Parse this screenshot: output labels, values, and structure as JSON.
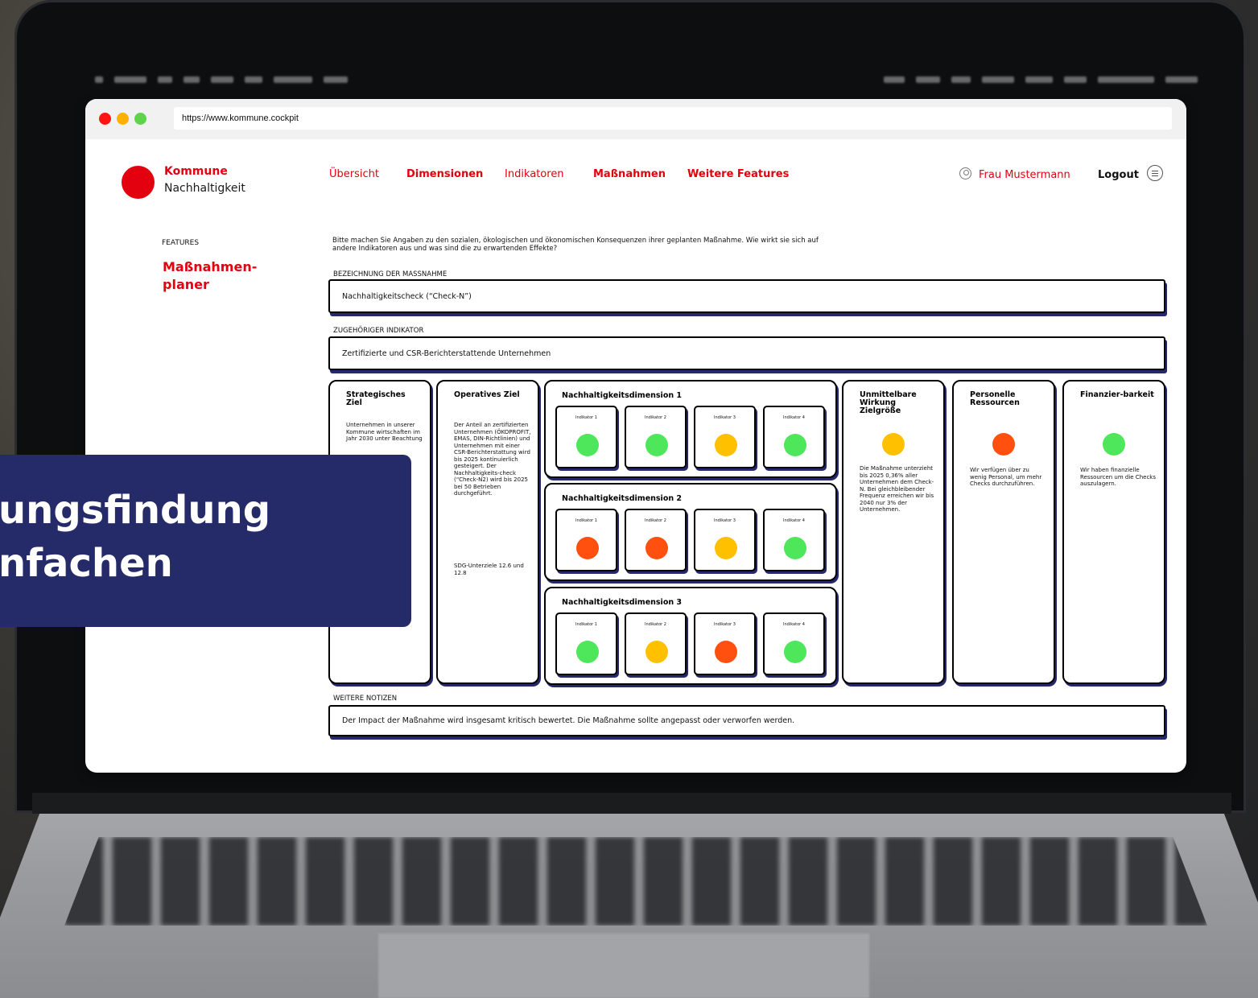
{
  "colors": {
    "accent": "#e3000f",
    "navy": "#252a68",
    "green": "#4ee65b",
    "yellow": "#ffc000",
    "orange": "#ff5010"
  },
  "browser": {
    "url": "https://www.kommune.cockpit"
  },
  "header": {
    "brand_line1": "Kommune",
    "brand_line2": "Nachhaltigkeit",
    "nav": [
      "Übersicht",
      "Dimensionen",
      "Indikatoren",
      "Maßnahmen",
      "Weitere Features"
    ],
    "user_name": "Frau Mustermann",
    "logout": "Logout"
  },
  "sidebar": {
    "label": "FEATURES",
    "title": "Maßnahmen-planer"
  },
  "form": {
    "intro": "Bitte machen Sie Angaben zu den sozialen, ökologischen und ökonomischen Konsequenzen ihrer geplanten Maßnahme. Wie wirkt sie sich auf andere Indikatoren aus und was sind die zu erwartenden Effekte?",
    "name_label": "BEZEICHNUNG DER MASSNAHME",
    "name_value": "Nachhaltigkeitscheck (“Check-N”)",
    "indicator_label": "ZUGEHÖRIGER INDIKATOR",
    "indicator_value": "Zertifizierte und CSR-Berichterstattende Unternehmen",
    "notes_label": "WEITERE NOTIZEN",
    "notes_value": "Der Impact der Maßnahme wird insgesamt kritisch bewertet. Die Maßnahme sollte angepasst  oder verworfen werden."
  },
  "columns": {
    "strategic": {
      "title": "Strategisches Ziel",
      "text": "Unternehmen in unserer Kommune wirtschaften im Jahr 2030 unter Beachtung"
    },
    "operative": {
      "title": "Operatives Ziel",
      "text": "Der Anteil an zertifizierten Unternehmen (ÖKOPROFIT, EMAS, DIN-Richtlinien) und Unternehmen mit einer CSR-Berichterstattung wird bis 2025 kontinuierlich gesteigert. Der Nachhaltigkeits-check (“Check-N2) wird bis 2025 bei 50 Betrieben durchgeführt.",
      "sdg": "SDG-Unterziele 12.6 und 12.8"
    },
    "impact": {
      "title": "Unmittelbare Wirkung Zielgröße",
      "status": "yellow",
      "text": "Die Maßnahme unterzieht bis 2025 0,36% aller Unternehmen dem Check-N. Bei gleichbleibender Frequenz erreichen wir bis 2040 nur 3% der Unternehmen."
    },
    "personnel": {
      "title": "Personelle Ressourcen",
      "status": "orange",
      "text": "Wir verfügen über zu wenig Personal, um mehr Checks durchzuführen."
    },
    "finance": {
      "title": "Finanzier-barkeit",
      "status": "green",
      "text": "Wir haben finanzielle Ressourcen um die Checks auszulagern."
    }
  },
  "dimensions": [
    {
      "title": "Nachhaltigkeitsdimension 1",
      "indicators": [
        {
          "label": "Indikator 1",
          "status": "green"
        },
        {
          "label": "Indikator 2",
          "status": "green"
        },
        {
          "label": "Indikator 3",
          "status": "yellow"
        },
        {
          "label": "Indikator 4",
          "status": "green"
        }
      ]
    },
    {
      "title": "Nachhaltigkeitsdimension 2",
      "indicators": [
        {
          "label": "Indikator 1",
          "status": "orange"
        },
        {
          "label": "Indikator 2",
          "status": "orange"
        },
        {
          "label": "Indikator 3",
          "status": "yellow"
        },
        {
          "label": "Indikator 4",
          "status": "green"
        }
      ]
    },
    {
      "title": "Nachhaltigkeitsdimension 3",
      "indicators": [
        {
          "label": "Indikator 1",
          "status": "green"
        },
        {
          "label": "Indikator 2",
          "status": "yellow"
        },
        {
          "label": "Indikator 3",
          "status": "orange"
        },
        {
          "label": "Indikator 4",
          "status": "green"
        }
      ]
    }
  ],
  "banner": {
    "line1": "ungsfindung",
    "line2": "nfachen"
  }
}
